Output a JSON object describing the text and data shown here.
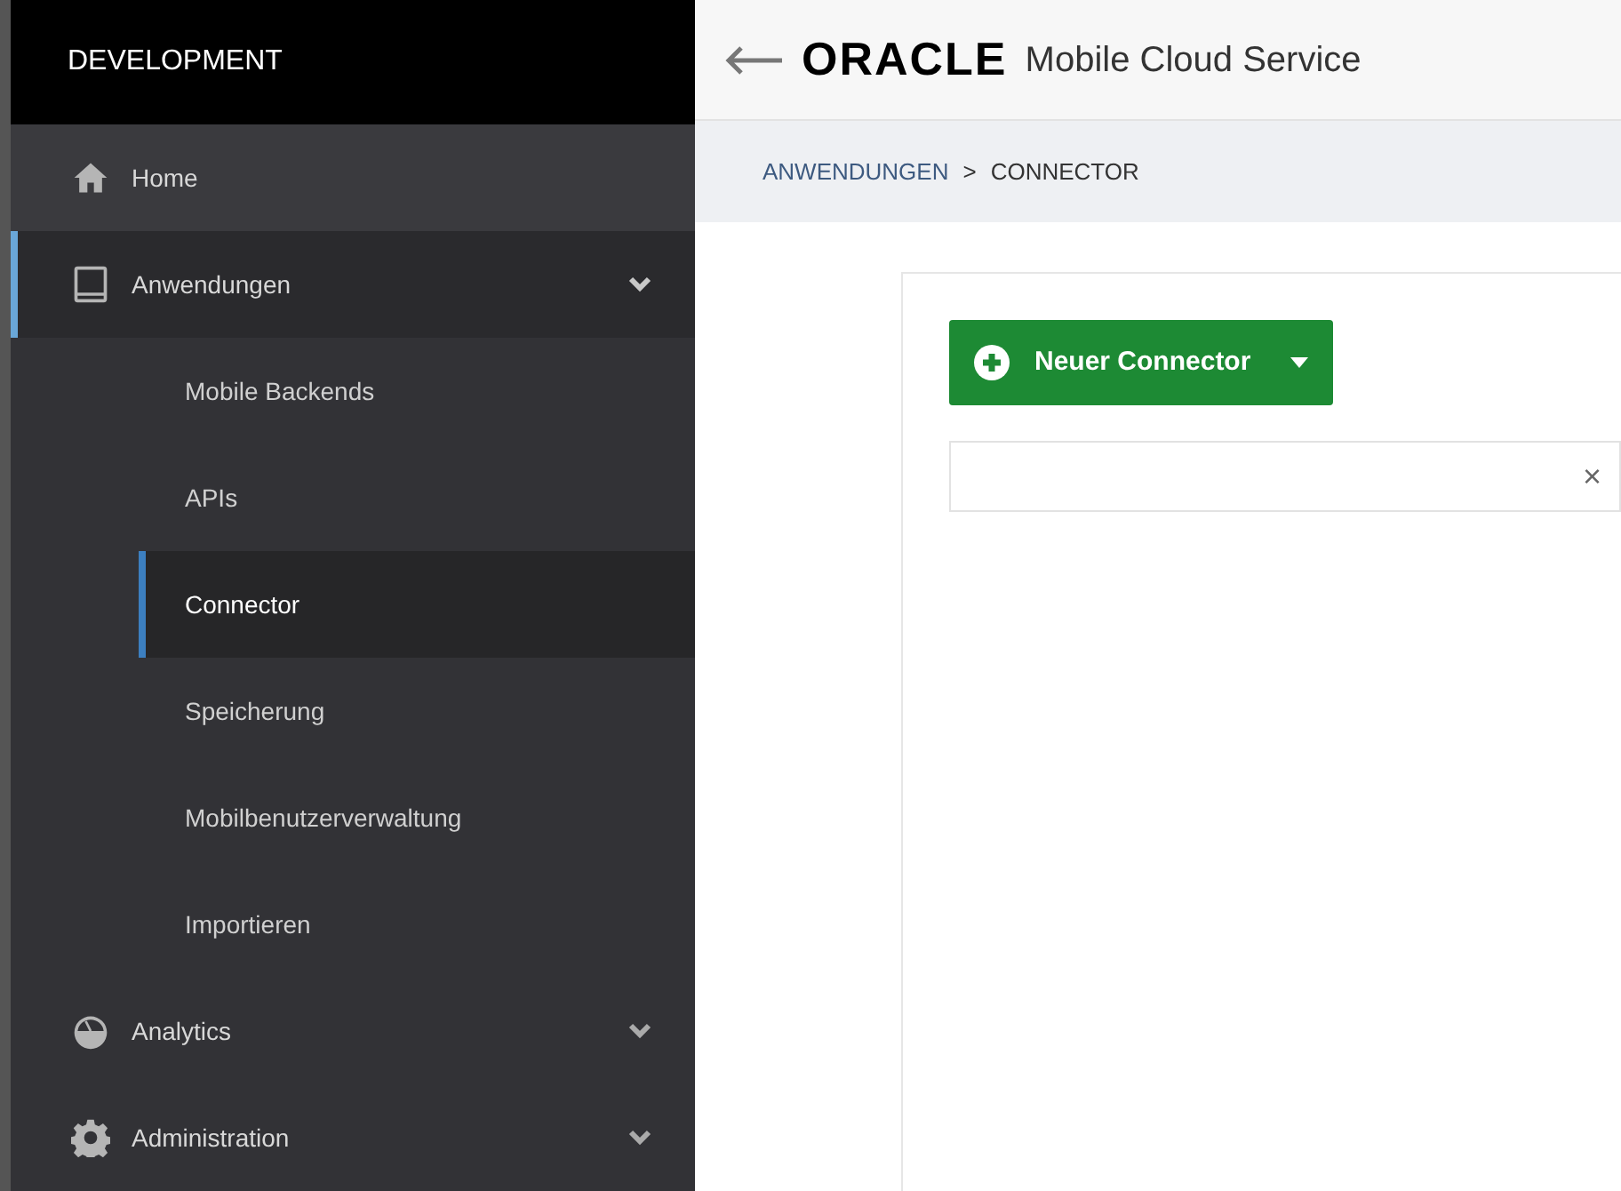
{
  "sidebar": {
    "title": "DEVELOPMENT",
    "items": [
      {
        "label": "Home",
        "selected": false
      },
      {
        "label": "Anwendungen",
        "selected": true,
        "expanded": true,
        "children": [
          {
            "label": "Mobile Backends",
            "selected": false
          },
          {
            "label": "APIs",
            "selected": false
          },
          {
            "label": "Connector",
            "selected": true
          },
          {
            "label": "Speicherung",
            "selected": false
          },
          {
            "label": "Mobilbenutzerverwaltung",
            "selected": false
          },
          {
            "label": "Importieren",
            "selected": false
          }
        ]
      },
      {
        "label": "Analytics",
        "selected": false,
        "expanded": false
      },
      {
        "label": "Administration",
        "selected": false,
        "expanded": false
      }
    ]
  },
  "header": {
    "logo": "ORACLE",
    "title": "Mobile Cloud Service"
  },
  "breadcrumb": [
    {
      "label": "ANWENDUNGEN",
      "link": true
    },
    {
      "label": ">",
      "link": false
    },
    {
      "label": "CONNECTOR",
      "link": false
    }
  ],
  "new_button": {
    "label": "Neuer Connector"
  },
  "filter": {
    "clear": "×"
  }
}
